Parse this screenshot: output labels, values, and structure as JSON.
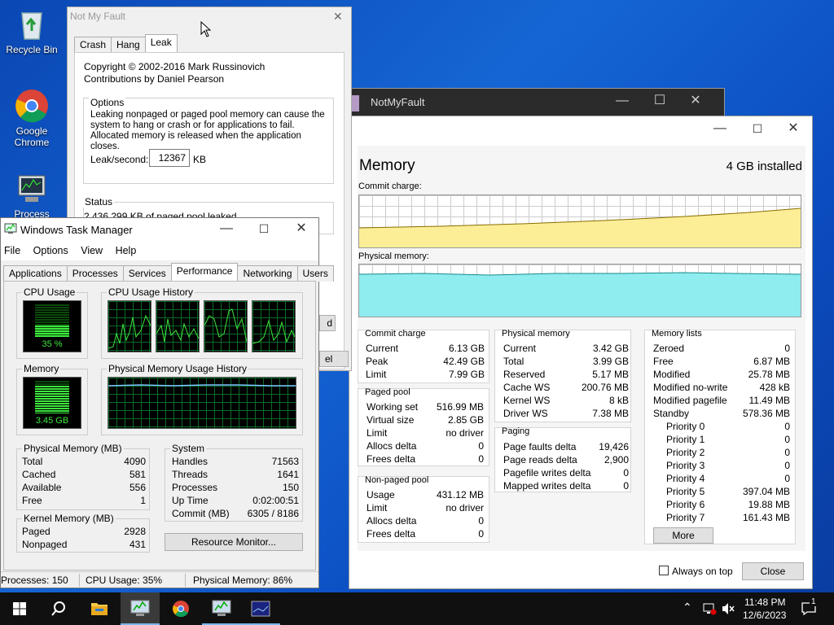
{
  "desktop": {
    "icons": [
      {
        "label": "Recycle Bin",
        "icon": "recycle-bin-icon"
      },
      {
        "label": "Google Chrome",
        "icon": "chrome-icon"
      },
      {
        "label": "Process",
        "icon": "process-explorer-icon"
      }
    ]
  },
  "notmyfault": {
    "title": "Not My Fault",
    "tabs": [
      "Crash",
      "Hang",
      "Leak"
    ],
    "active_tab": "Leak",
    "copyright": "Copyright © 2002-2016 Mark Russinovich",
    "contributions": "Contributions by Daniel Pearson",
    "options_label": "Options",
    "options_text": "Leaking nonpaged or paged pool memory can cause the system to hang or crash or for applications to fail. Allocated memory is released when the application closes.",
    "leak_label": "Leak/second:",
    "leak_value": "12367",
    "leak_unit": "KB",
    "status_label": "Status",
    "status_text": "2,436,299 KB of paged pool leaked.",
    "partial_btn1": "d",
    "partial_btn2": "el"
  },
  "notmyfault_back": {
    "title": "NotMyFault"
  },
  "resmon": {
    "title": "Memory",
    "installed": "4 GB installed",
    "commit_charge_label": "Commit charge:",
    "physical_memory_label": "Physical memory:",
    "commit_charge": {
      "title": "Commit charge",
      "rows": [
        {
          "k": "Current",
          "v": "6.13 GB"
        },
        {
          "k": "Peak",
          "v": "42.49 GB"
        },
        {
          "k": "Limit",
          "v": "7.99 GB"
        }
      ]
    },
    "paged_pool": {
      "title": "Paged pool",
      "rows": [
        {
          "k": "Working set",
          "v": "516.99 MB"
        },
        {
          "k": "Virtual size",
          "v": "2.85 GB"
        },
        {
          "k": "Limit",
          "v": "no driver"
        },
        {
          "k": "Allocs delta",
          "v": "0"
        },
        {
          "k": "Frees delta",
          "v": "0"
        }
      ]
    },
    "nonpaged_pool": {
      "title": "Non-paged pool",
      "rows": [
        {
          "k": "Usage",
          "v": "431.12 MB"
        },
        {
          "k": "Limit",
          "v": "no driver"
        },
        {
          "k": "Allocs delta",
          "v": "0"
        },
        {
          "k": "Frees delta",
          "v": "0"
        }
      ]
    },
    "physical_memory": {
      "title": "Physical memory",
      "rows": [
        {
          "k": "Current",
          "v": "3.42 GB"
        },
        {
          "k": "Total",
          "v": "3.99 GB"
        },
        {
          "k": "Reserved",
          "v": "5.17 MB"
        },
        {
          "k": "Cache WS",
          "v": "200.76 MB"
        },
        {
          "k": "Kernel WS",
          "v": "8 kB"
        },
        {
          "k": "Driver WS",
          "v": "7.38 MB"
        }
      ]
    },
    "paging": {
      "title": "Paging",
      "rows": [
        {
          "k": "Page faults delta",
          "v": "19,426"
        },
        {
          "k": "Page reads delta",
          "v": "2,900"
        },
        {
          "k": "Pagefile writes delta",
          "v": "0"
        },
        {
          "k": "Mapped writes delta",
          "v": "0"
        }
      ]
    },
    "memory_lists": {
      "title": "Memory lists",
      "rows": [
        {
          "k": "Zeroed",
          "v": "0"
        },
        {
          "k": "Free",
          "v": "6.87 MB"
        },
        {
          "k": "Modified",
          "v": "25.78 MB"
        },
        {
          "k": "Modified no-write",
          "v": "428 kB"
        },
        {
          "k": "Modified pagefile",
          "v": "11.49 MB"
        },
        {
          "k": "Standby",
          "v": "578.36 MB"
        },
        {
          "k": "Priority 0",
          "v": "0"
        },
        {
          "k": "Priority 1",
          "v": "0"
        },
        {
          "k": "Priority 2",
          "v": "0"
        },
        {
          "k": "Priority 3",
          "v": "0"
        },
        {
          "k": "Priority 4",
          "v": "0"
        },
        {
          "k": "Priority 5",
          "v": "397.04 MB"
        },
        {
          "k": "Priority 6",
          "v": "19.88 MB"
        },
        {
          "k": "Priority 7",
          "v": "161.43 MB"
        }
      ]
    },
    "more_btn": "More",
    "always_on_top": "Always on top",
    "close_btn": "Close"
  },
  "taskmgr": {
    "title": "Windows Task Manager",
    "menu": [
      "File",
      "Options",
      "View",
      "Help"
    ],
    "tabs": [
      "Applications",
      "Processes",
      "Services",
      "Performance",
      "Networking",
      "Users"
    ],
    "active_tab": "Performance",
    "cpu_usage_label": "CPU Usage",
    "cpu_usage_value": "35 %",
    "cpu_fraction": 0.35,
    "cpu_history_label": "CPU Usage History",
    "memory_label": "Memory",
    "memory_value": "3.45 GB",
    "memory_fraction": 0.86,
    "phys_history_label": "Physical Memory Usage History",
    "physical_memory": {
      "title": "Physical Memory (MB)",
      "rows": [
        {
          "k": "Total",
          "v": "4090"
        },
        {
          "k": "Cached",
          "v": "581"
        },
        {
          "k": "Available",
          "v": "556"
        },
        {
          "k": "Free",
          "v": "1"
        }
      ]
    },
    "kernel_memory": {
      "title": "Kernel Memory (MB)",
      "rows": [
        {
          "k": "Paged",
          "v": "2928"
        },
        {
          "k": "Nonpaged",
          "v": "431"
        }
      ]
    },
    "system": {
      "title": "System",
      "rows": [
        {
          "k": "Handles",
          "v": "71563"
        },
        {
          "k": "Threads",
          "v": "1641"
        },
        {
          "k": "Processes",
          "v": "150"
        },
        {
          "k": "Up Time",
          "v": "0:02:00:51"
        },
        {
          "k": "Commit (MB)",
          "v": "6305 / 8186"
        }
      ]
    },
    "resource_monitor_btn": "Resource Monitor...",
    "status": {
      "processes": "Processes: 150",
      "cpu": "CPU Usage: 35%",
      "memory": "Physical Memory: 86%"
    }
  },
  "taskbar": {
    "time": "11:48 PM",
    "date": "12/6/2023",
    "notifications": "1",
    "colors": {
      "bar": "#101010",
      "accent": "#0078d7"
    }
  }
}
